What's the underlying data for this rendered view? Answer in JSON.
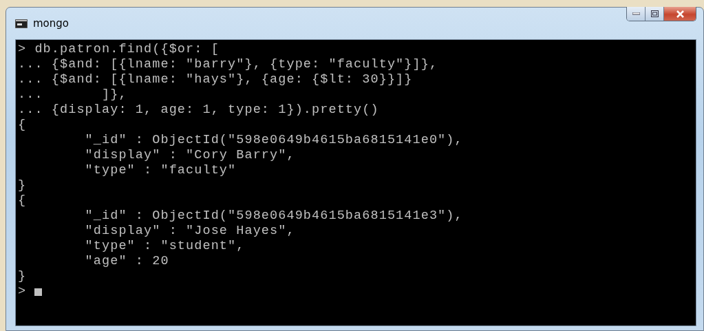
{
  "window": {
    "title": "mongo"
  },
  "console": {
    "lines": [
      "> db.patron.find({$or: [",
      "... {$and: [{lname: \"barry\"}, {type: \"faculty\"}]},",
      "... {$and: [{lname: \"hays\"}, {age: {$lt: 30}}]}",
      "...       ]},",
      "... {display: 1, age: 1, type: 1}).pretty()",
      "{",
      "        \"_id\" : ObjectId(\"598e0649b4615ba6815141e0\"),",
      "        \"display\" : \"Cory Barry\",",
      "        \"type\" : \"faculty\"",
      "}",
      "{",
      "        \"_id\" : ObjectId(\"598e0649b4615ba6815141e3\"),",
      "        \"display\" : \"Jose Hayes\",",
      "        \"type\" : \"student\",",
      "        \"age\" : 20",
      "}"
    ],
    "prompt": ">"
  }
}
